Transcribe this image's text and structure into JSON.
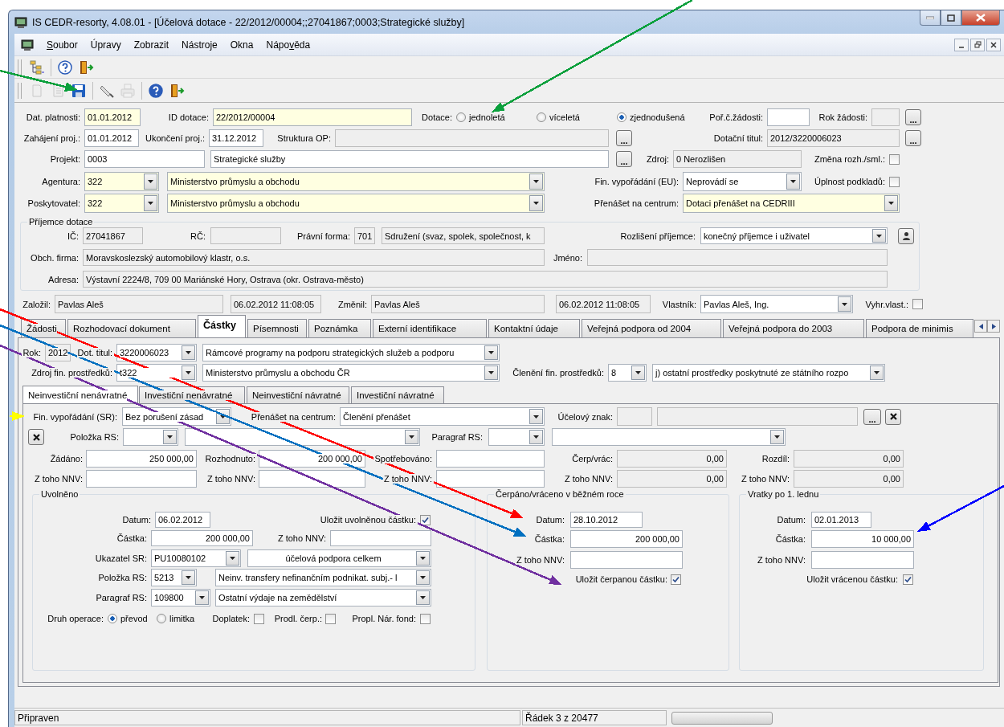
{
  "window": {
    "title": "IS CEDR-resorty, 4.08.01 - [Účelová dotace - 22/2012/00004;;27041867;0003;Strategické služby]"
  },
  "menu": [
    {
      "access_key": "S",
      "label_end": "oubor"
    },
    {
      "label_end": "Úpravy"
    },
    {
      "label_end": "Zobrazit"
    },
    {
      "label_end": "Nástroje"
    },
    {
      "label_end": "Okna"
    },
    {
      "label_start": "Nápo",
      "access_key": "v",
      "label_end": "ěda"
    }
  ],
  "toolbars": [
    {
      "groups": [
        {
          "items": [
            {
              "kind": "tree",
              "disabled": false
            }
          ]
        },
        {
          "items": [
            {
              "kind": "help",
              "disabled": false
            },
            {
              "kind": "exit",
              "disabled": false
            }
          ]
        }
      ]
    },
    {
      "groups": [
        {
          "items": [
            {
              "kind": "page",
              "disabled": true
            },
            {
              "kind": "list",
              "disabled": true
            },
            {
              "kind": "save",
              "disabled": false
            }
          ]
        },
        {
          "items": [
            {
              "kind": "eraser",
              "disabled": false
            },
            {
              "kind": "print",
              "disabled": true
            }
          ]
        },
        {
          "items": [
            {
              "kind": "help",
              "disabled": false
            },
            {
              "kind": "exit",
              "disabled": false
            }
          ]
        }
      ]
    }
  ],
  "form": {
    "rows": [
      {
        "items": [
          {
            "kind": "label",
            "text": "Dat. platnosti:"
          },
          {
            "kind": "field",
            "required": true,
            "readonly": false,
            "value": "01.01.2012"
          },
          {
            "kind": "label",
            "text": "ID dotace:"
          },
          {
            "kind": "field",
            "required": true,
            "readonly": false,
            "value": "22/2012/00004"
          },
          {
            "kind": "label",
            "text": "Dotace:"
          },
          {
            "kind": "radio",
            "label": "jednoletá",
            "selected": false
          },
          {
            "kind": "radio",
            "label": "víceletá",
            "selected": false
          },
          {
            "kind": "radio",
            "label": "zjednodušená",
            "selected": true
          },
          {
            "kind": "label",
            "text": "Poř.č.žádosti:"
          },
          {
            "kind": "field",
            "required": false,
            "readonly": false
          },
          {
            "kind": "label",
            "text": "Rok žádosti:"
          },
          {
            "kind": "field",
            "required": false,
            "readonly": true
          },
          {
            "kind": "button",
            "label": "..."
          }
        ]
      },
      {
        "items": [
          {
            "kind": "label",
            "text": "Zahájení proj.:"
          },
          {
            "kind": "field",
            "required": false,
            "readonly": false,
            "value": "01.01.2012"
          },
          {
            "kind": "label",
            "text": "Ukončení proj.:"
          },
          {
            "kind": "field",
            "required": false,
            "readonly": false,
            "value": "31.12.2012"
          },
          {
            "kind": "label",
            "text": "Struktura OP:"
          },
          {
            "kind": "field",
            "required": false,
            "readonly": true
          },
          {
            "kind": "button",
            "label": "..."
          },
          {
            "kind": "label",
            "text": "Dotační titul:"
          },
          {
            "kind": "field",
            "required": false,
            "readonly": true,
            "value": "2012/3220006023"
          },
          {
            "kind": "button",
            "label": "..."
          }
        ]
      },
      {
        "items": [
          {
            "kind": "label",
            "text": "Projekt:"
          },
          {
            "kind": "field",
            "required": false,
            "readonly": false,
            "value": "0003"
          },
          {
            "kind": "field",
            "required": false,
            "readonly": false,
            "value": "Strategické služby"
          },
          {
            "kind": "button",
            "label": "..."
          },
          {
            "kind": "label",
            "text": "Zdroj:"
          },
          {
            "kind": "field",
            "required": false,
            "readonly": true,
            "value": "0 Nerozlišen"
          },
          {
            "kind": "label",
            "text": "Změna rozh./sml.:"
          },
          {
            "kind": "check",
            "checked": false
          }
        ]
      },
      {
        "items": [
          {
            "kind": "label",
            "text": "Agentura:"
          },
          {
            "kind": "combo",
            "required": true,
            "readonly": false,
            "value": "322"
          },
          {
            "kind": "combo",
            "required": true,
            "readonly": false,
            "value": "Ministerstvo průmyslu a obchodu"
          },
          {
            "kind": "label",
            "text": "Fin. vypořádání (EU):"
          },
          {
            "kind": "combo",
            "required": false,
            "readonly": false,
            "value": "Neprovádí se"
          },
          {
            "kind": "label",
            "text": "Úplnost podkladů:"
          },
          {
            "kind": "check",
            "checked": false
          }
        ]
      },
      {
        "items": [
          {
            "kind": "label",
            "text": "Poskytovatel:"
          },
          {
            "kind": "combo",
            "required": true,
            "readonly": false,
            "value": "322"
          },
          {
            "kind": "combo",
            "required": true,
            "readonly": false,
            "value": "Ministerstvo průmyslu a obchodu"
          },
          {
            "kind": "label",
            "text": "Přenášet na centrum:"
          },
          {
            "kind": "combo",
            "required": true,
            "readonly": false,
            "value": "Dotaci přenášet na CEDRIII"
          }
        ]
      }
    ],
    "recipient": {
      "title": "Příjemce dotace",
      "rows": [
        {
          "items": [
            {
              "kind": "label",
              "text": "IČ:"
            },
            {
              "kind": "field",
              "required": false,
              "readonly": true,
              "value": "27041867"
            },
            {
              "kind": "label",
              "text": "RČ:"
            },
            {
              "kind": "field",
              "required": false,
              "readonly": true
            },
            {
              "kind": "label",
              "text": "Právní forma:"
            },
            {
              "kind": "field",
              "required": false,
              "readonly": true,
              "value": "701"
            },
            {
              "kind": "field",
              "required": false,
              "readonly": true,
              "value": "Sdružení (svaz, spolek, společnost, k"
            },
            {
              "kind": "label",
              "text": "Rozlišení příjemce:"
            },
            {
              "kind": "combo",
              "required": false,
              "readonly": false,
              "value": "konečný příjemce i uživatel"
            },
            {
              "kind": "lookup"
            }
          ]
        },
        {
          "items": [
            {
              "kind": "label",
              "text": "Obch. firma:"
            },
            {
              "kind": "field",
              "required": false,
              "readonly": true,
              "value": "Moravskoslezský automobilový klastr, o.s."
            },
            {
              "kind": "label",
              "text": "Jméno:"
            },
            {
              "kind": "field",
              "required": false,
              "readonly": true
            }
          ]
        },
        {
          "items": [
            {
              "kind": "label",
              "text": "Adresa:"
            },
            {
              "kind": "field",
              "required": false,
              "readonly": true,
              "value": "Výstavní 2224/8, 709 00 Mariánské Hory, Ostrava (okr. Ostrava-město)"
            }
          ]
        }
      ]
    },
    "audit_row": {
      "items": [
        {
          "kind": "label",
          "text": "Založil:"
        },
        {
          "kind": "field",
          "required": false,
          "readonly": true,
          "value": "Pavlas Aleš"
        },
        {
          "kind": "field",
          "required": false,
          "readonly": true,
          "value": "06.02.2012 11:08:05"
        },
        {
          "kind": "label",
          "text": "Změnil:"
        },
        {
          "kind": "field",
          "required": false,
          "readonly": true,
          "value": "Pavlas Aleš"
        },
        {
          "kind": "field",
          "required": false,
          "readonly": true,
          "value": "06.02.2012 11:08:05"
        },
        {
          "kind": "label",
          "text": "Vlastník:"
        },
        {
          "kind": "combo",
          "required": false,
          "readonly": false,
          "value": "Pavlas Aleš, Ing."
        },
        {
          "kind": "label",
          "text": "Vyhr.vlast.:"
        },
        {
          "kind": "check",
          "checked": false
        }
      ]
    }
  },
  "tabs": [
    {
      "label": "Žádosti",
      "selected": false
    },
    {
      "label": "Rozhodovací dokument",
      "selected": false
    },
    {
      "label": "Částky",
      "selected": true
    },
    {
      "label": "Písemnosti",
      "selected": false
    },
    {
      "label": "Poznámka",
      "selected": false
    },
    {
      "label": "Externí identifikace",
      "selected": false
    },
    {
      "label": "Kontaktní údaje",
      "selected": false
    },
    {
      "label": "Veřejná podpora od 2004",
      "selected": false
    },
    {
      "label": "Veřejná podpora do 2003",
      "selected": false
    },
    {
      "label": "Podpora de minimis",
      "selected": false
    }
  ],
  "amounts": {
    "rows": [
      {
        "items": [
          {
            "kind": "label",
            "text": "Rok:"
          },
          {
            "kind": "field",
            "required": false,
            "readonly": true,
            "value": "2012"
          },
          {
            "kind": "label",
            "text": "Dot. titul:"
          },
          {
            "kind": "combo",
            "required": false,
            "readonly": false,
            "value": "3220006023"
          },
          {
            "kind": "combo",
            "required": false,
            "readonly": false,
            "value": "Rámcové programy na podporu strategických služeb a podporu"
          }
        ]
      },
      {
        "items": [
          {
            "kind": "label",
            "text": "Zdroj fin. prostředků:"
          },
          {
            "kind": "combo",
            "required": false,
            "readonly": false,
            "value": "t322"
          },
          {
            "kind": "combo",
            "required": false,
            "readonly": false,
            "value": "Ministerstvo průmyslu a obchodu ČR"
          },
          {
            "kind": "label",
            "text": "Členění fin. prostředků:"
          },
          {
            "kind": "combo",
            "required": false,
            "readonly": false,
            "value": "8"
          },
          {
            "kind": "combo",
            "required": false,
            "readonly": false,
            "value": "j) ostatní prostředky poskytnuté ze státního rozpo"
          }
        ]
      }
    ],
    "subtabs": [
      {
        "label": "Neinvestiční nenávratné",
        "selected": true
      },
      {
        "label": "Investiční nenávratné",
        "selected": false
      },
      {
        "label": "Neinvestiční návratné",
        "selected": false
      },
      {
        "label": "Investiční návratné",
        "selected": false
      }
    ],
    "sub_rows": [
      {
        "items": [
          {
            "kind": "label",
            "text": "Fin. vypořádání (SR):"
          },
          {
            "kind": "combo",
            "required": false,
            "readonly": false,
            "value": "Bez porušení zásad"
          },
          {
            "kind": "label",
            "text": "Přenášet na centrum:"
          },
          {
            "kind": "combo",
            "required": false,
            "readonly": false,
            "value": "Členění přenášet"
          },
          {
            "kind": "label",
            "text": "Účelový znak:"
          },
          {
            "kind": "field",
            "required": false,
            "readonly": true
          },
          {
            "kind": "field",
            "required": false,
            "readonly": true
          },
          {
            "kind": "button",
            "label": "..."
          },
          {
            "kind": "clear"
          }
        ]
      },
      {
        "items": [
          {
            "kind": "clear"
          },
          {
            "kind": "label",
            "text": "Položka RS:"
          },
          {
            "kind": "combo",
            "required": false,
            "readonly": false
          },
          {
            "kind": "combo",
            "required": false,
            "readonly": false
          },
          {
            "kind": "label",
            "text": "Paragraf RS:"
          },
          {
            "kind": "combo",
            "required": false,
            "readonly": false
          },
          {
            "kind": "combo",
            "required": false,
            "readonly": false
          }
        ]
      },
      {
        "items": [
          {
            "kind": "label",
            "text": "Žádáno:"
          },
          {
            "kind": "field",
            "required": false,
            "readonly": false,
            "value": "250 000,00"
          },
          {
            "kind": "label",
            "text": "Rozhodnuto:"
          },
          {
            "kind": "field",
            "required": false,
            "readonly": false,
            "value": "200 000,00"
          },
          {
            "kind": "label",
            "text": "Spotřebováno:"
          },
          {
            "kind": "field",
            "required": false,
            "readonly": false
          },
          {
            "kind": "label",
            "text": "Čerp/vrác:"
          },
          {
            "kind": "field",
            "required": false,
            "readonly": true,
            "value": "0,00"
          },
          {
            "kind": "label",
            "text": "Rozdíl:"
          },
          {
            "kind": "field",
            "required": false,
            "readonly": true,
            "value": "0,00"
          }
        ]
      },
      {
        "items": [
          {
            "kind": "label",
            "text": "Z toho NNV:"
          },
          {
            "kind": "field",
            "required": false,
            "readonly": false
          },
          {
            "kind": "label",
            "text": "Z toho NNV:"
          },
          {
            "kind": "field",
            "required": false,
            "readonly": false
          },
          {
            "kind": "label",
            "text": "Z toho NNV:"
          },
          {
            "kind": "field",
            "required": false,
            "readonly": false
          },
          {
            "kind": "label",
            "text": "Z toho NNV:"
          },
          {
            "kind": "field",
            "required": false,
            "readonly": true,
            "value": "0,00"
          },
          {
            "kind": "label",
            "text": "Z toho NNV:"
          },
          {
            "kind": "field",
            "required": false,
            "readonly": true,
            "value": "0,00"
          }
        ]
      }
    ],
    "groups": [
      {
        "title": "Uvolněno",
        "rows": [
          {
            "items": [
              {
                "kind": "label",
                "text": "Datum:"
              },
              {
                "kind": "field",
                "required": false,
                "readonly": false,
                "value": "06.02.2012"
              },
              {
                "kind": "label",
                "text": "Uložit uvolněnou částku:"
              },
              {
                "kind": "check",
                "checked": true
              }
            ]
          },
          {
            "items": [
              {
                "kind": "label",
                "text": "Částka:"
              },
              {
                "kind": "field",
                "required": false,
                "readonly": false,
                "value": "200 000,00"
              },
              {
                "kind": "label",
                "text": "Z toho NNV:"
              },
              {
                "kind": "field",
                "required": false,
                "readonly": false
              }
            ]
          },
          {
            "items": [
              {
                "kind": "label",
                "text": "Ukazatel SR:"
              },
              {
                "kind": "combo",
                "required": false,
                "readonly": false,
                "value": "PU10080102"
              },
              {
                "kind": "combo",
                "required": false,
                "readonly": false,
                "value": "účelová podpora celkem"
              }
            ]
          },
          {
            "items": [
              {
                "kind": "label",
                "text": "Položka RS:"
              },
              {
                "kind": "combo",
                "required": false,
                "readonly": false,
                "value": "5213"
              },
              {
                "kind": "combo",
                "required": false,
                "readonly": false,
                "value": "Neinv. transfery nefinančním podnikat. subj.- l"
              }
            ]
          },
          {
            "items": [
              {
                "kind": "label",
                "text": "Paragraf RS:"
              },
              {
                "kind": "combo",
                "required": false,
                "readonly": false,
                "value": "109800"
              },
              {
                "kind": "combo",
                "required": false,
                "readonly": false,
                "value": "Ostatní výdaje na zemědělství"
              }
            ]
          },
          {
            "items": [
              {
                "kind": "label",
                "text": "Druh operace:"
              },
              {
                "kind": "radio",
                "label": "převod",
                "selected": true
              },
              {
                "kind": "radio",
                "label": "limitka",
                "selected": false
              },
              {
                "kind": "label",
                "text": "Doplatek:"
              },
              {
                "kind": "check",
                "checked": false
              },
              {
                "kind": "label",
                "text": "Prodl. čerp.:"
              },
              {
                "kind": "check",
                "checked": false
              },
              {
                "kind": "label",
                "text": "Propl. Nár. fond:"
              },
              {
                "kind": "check",
                "checked": false
              }
            ]
          }
        ]
      },
      {
        "title": "Čerpáno/vráceno v běžném roce",
        "rows": [
          {
            "items": [
              {
                "kind": "label",
                "text": "Datum:"
              },
              {
                "kind": "field",
                "required": false,
                "readonly": false,
                "value": "28.10.2012"
              }
            ]
          },
          {
            "items": [
              {
                "kind": "label",
                "text": "Částka:"
              },
              {
                "kind": "field",
                "required": false,
                "readonly": false,
                "value": "200 000,00"
              }
            ]
          },
          {
            "items": [
              {
                "kind": "label",
                "text": "Z toho NNV:"
              },
              {
                "kind": "field",
                "required": false,
                "readonly": false
              }
            ]
          },
          {
            "items": [
              {
                "kind": "label",
                "text": "Uložit čerpanou částku:"
              },
              {
                "kind": "check",
                "checked": true
              }
            ]
          }
        ]
      },
      {
        "title": "Vratky po 1. lednu",
        "rows": [
          {
            "items": [
              {
                "kind": "label",
                "text": "Datum:"
              },
              {
                "kind": "field",
                "required": false,
                "readonly": false,
                "value": "02.01.2013"
              }
            ]
          },
          {
            "items": [
              {
                "kind": "label",
                "text": "Částka:"
              },
              {
                "kind": "field",
                "required": false,
                "readonly": false,
                "value": "10 000,00"
              }
            ]
          },
          {
            "items": [
              {
                "kind": "label",
                "text": "Z toho NNV:"
              },
              {
                "kind": "field",
                "required": false,
                "readonly": false
              }
            ]
          },
          {
            "items": [
              {
                "kind": "label",
                "text": "Uložit vrácenou částku:"
              },
              {
                "kind": "check",
                "checked": true
              }
            ]
          }
        ]
      }
    ]
  },
  "status_bar": {
    "text": "Připraven",
    "position": "Řádek 3 z 20477",
    "progress": {
      "level": 0
    }
  },
  "annotations": [
    {
      "color": "#0aa03c"
    },
    {
      "color": "#0aa03c"
    },
    {
      "color": "#ff0000"
    },
    {
      "color": "#0070c0"
    },
    {
      "color": "#7030a0"
    },
    {
      "color": "#ffff00"
    },
    {
      "color": "#0000ff"
    }
  ]
}
